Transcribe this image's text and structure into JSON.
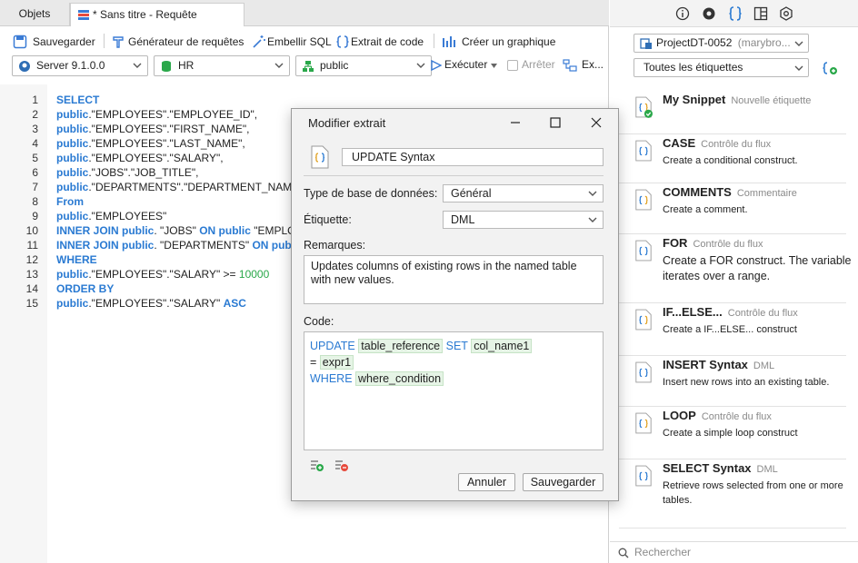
{
  "tabs": {
    "objects": "Objets",
    "query": "* Sans titre - Requête"
  },
  "toolbar": {
    "save": "Sauvegarder",
    "query_builder": "Générateur de requêtes",
    "beautify": "Embellir SQL",
    "code_snippet": "Extrait de code",
    "chart": "Créer un graphique"
  },
  "selectors": {
    "server": "Server 9.1.0.0",
    "database": "HR",
    "schema": "public",
    "run": "Exécuter",
    "stop": "Arrêter",
    "explain": "Ex..."
  },
  "editor": {
    "lines": [
      {
        "n": "1",
        "parts": [
          {
            "t": "SELECT",
            "c": "kw"
          }
        ]
      },
      {
        "n": "2",
        "parts": [
          {
            "t": "public",
            "c": "kw"
          },
          {
            "t": ".\"EMPLOYEES\".\"EMPLOYEE_ID\",",
            "c": "str"
          }
        ]
      },
      {
        "n": "3",
        "parts": [
          {
            "t": "public",
            "c": "kw"
          },
          {
            "t": ".\"EMPLOYEES\".\"FIRST_NAME\",",
            "c": "str"
          }
        ]
      },
      {
        "n": "4",
        "parts": [
          {
            "t": "public",
            "c": "kw"
          },
          {
            "t": ".\"EMPLOYEES\".\"LAST_NAME\",",
            "c": "str"
          }
        ]
      },
      {
        "n": "5",
        "parts": [
          {
            "t": "public",
            "c": "kw"
          },
          {
            "t": ".\"EMPLOYEES\".\"SALARY\",",
            "c": "str"
          }
        ]
      },
      {
        "n": "6",
        "parts": [
          {
            "t": "public",
            "c": "kw"
          },
          {
            "t": ".\"JOBS\".\"JOB_TITLE\",",
            "c": "str"
          }
        ]
      },
      {
        "n": "7",
        "parts": [
          {
            "t": "public",
            "c": "kw"
          },
          {
            "t": ".\"DEPARTMENTS\".\"DEPARTMENT_NAME\",",
            "c": "str"
          }
        ]
      },
      {
        "n": "8",
        "parts": [
          {
            "t": "From",
            "c": "kw"
          }
        ]
      },
      {
        "n": "9",
        "parts": [
          {
            "t": "public",
            "c": "kw"
          },
          {
            "t": ".\"EMPLOYEES\"",
            "c": "str"
          }
        ]
      },
      {
        "n": "10",
        "parts": [
          {
            "t": "INNER JOIN public",
            "c": "kw"
          },
          {
            "t": ". \"JOBS\" ",
            "c": "str"
          },
          {
            "t": "ON public",
            "c": "kw"
          },
          {
            "t": " \"EMPLO",
            "c": "str"
          }
        ]
      },
      {
        "n": "11",
        "parts": [
          {
            "t": "INNER JOIN public",
            "c": "kw"
          },
          {
            "t": ". \"DEPARTMENTS\" ",
            "c": "str"
          },
          {
            "t": "ON public",
            "c": "kw"
          }
        ]
      },
      {
        "n": "12",
        "parts": [
          {
            "t": "WHERE",
            "c": "kw"
          }
        ]
      },
      {
        "n": "13",
        "parts": [
          {
            "t": "public",
            "c": "kw"
          },
          {
            "t": ".\"EMPLOYEES\".\"SALARY\" >= ",
            "c": "str"
          },
          {
            "t": "10000",
            "c": "num"
          }
        ]
      },
      {
        "n": "14",
        "parts": [
          {
            "t": "ORDER BY",
            "c": "kw"
          }
        ]
      },
      {
        "n": "15",
        "parts": [
          {
            "t": "public",
            "c": "kw"
          },
          {
            "t": ".\"EMPLOYEES\".\"SALARY\" ",
            "c": "str"
          },
          {
            "t": "ASC",
            "c": "kw"
          }
        ]
      }
    ]
  },
  "right_panel": {
    "project": "ProjectDT-0052",
    "project_owner": "(marybro...",
    "labels_filter": "Toutes les étiquettes",
    "search_placeholder": "Rechercher",
    "snippets": [
      {
        "title": "My Snippet",
        "category": "Nouvelle étiquette",
        "desc": "",
        "style": "normal"
      },
      {
        "title": "CASE",
        "category": "Contrôle du flux",
        "desc": "Create a conditional construct.",
        "style": "normal"
      },
      {
        "title": "COMMENTS",
        "category": "Commentaire",
        "desc": "Create a comment.",
        "style": "normal"
      },
      {
        "title": "FOR",
        "category": "Contrôle du flux",
        "desc": "Create a FOR construct. The variable iterates over a range.",
        "style": "big"
      },
      {
        "title": "IF...ELSE...",
        "category": "Contrôle du flux",
        "desc": "Create a IF...ELSE... construct",
        "style": "normal"
      },
      {
        "title": "INSERT Syntax",
        "category": "DML",
        "desc": "Insert new rows into an existing table.",
        "style": "normal"
      },
      {
        "title": "LOOP",
        "category": "Contrôle du flux",
        "desc": "Create a simple loop construct",
        "style": "normal"
      },
      {
        "title": "SELECT Syntax",
        "category": "DML",
        "desc": "Retrieve rows selected from one or more tables.",
        "style": "normal"
      }
    ]
  },
  "dialog": {
    "title": "Modifier extrait",
    "name": "UPDATE Syntax",
    "db_type_label": "Type de base de données:",
    "db_type": "Général",
    "label_label": "Étiquette:",
    "label": "DML",
    "remarks_label": "Remarques:",
    "remarks": "Updates columns of existing rows in the named table with new values.",
    "code_label": "Code:",
    "code": {
      "kw_update": "UPDATE",
      "table_reference": "table_reference",
      "kw_set": "SET",
      "col_name": "col_name1",
      "eq": "=",
      "expr": "expr1",
      "kw_where": "WHERE",
      "where_condition": "where_condition"
    },
    "cancel": "Annuler",
    "save": "Sauvegarder"
  }
}
